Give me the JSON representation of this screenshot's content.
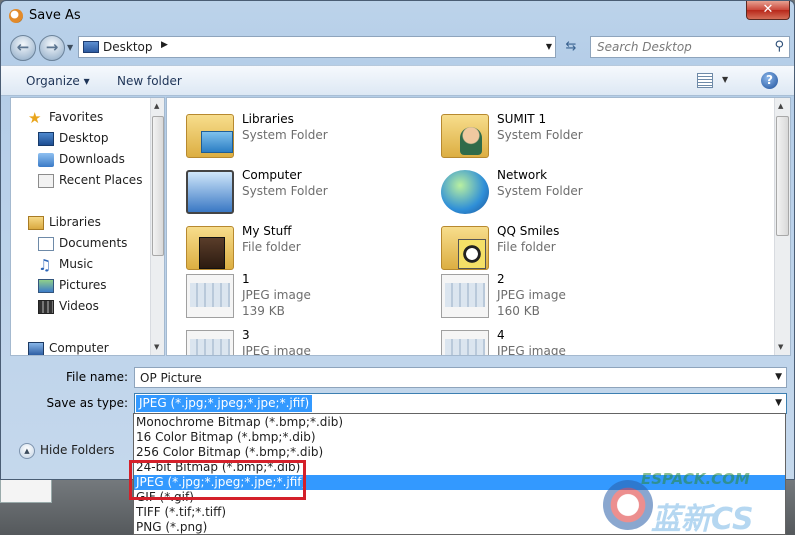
{
  "window": {
    "title": "Save As",
    "close_label": "✕"
  },
  "address": {
    "location": "Desktop",
    "search_placeholder": "Search Desktop"
  },
  "toolbar": {
    "organize": "Organize",
    "new_folder": "New folder"
  },
  "nav": {
    "favorites": "Favorites",
    "desktop": "Desktop",
    "downloads": "Downloads",
    "recent_places": "Recent Places",
    "libraries": "Libraries",
    "documents": "Documents",
    "music": "Music",
    "pictures": "Pictures",
    "videos": "Videos",
    "computer": "Computer"
  },
  "files": [
    {
      "name": "Libraries",
      "type": "System Folder",
      "size": "",
      "icon": "libraries-icon"
    },
    {
      "name": "SUMIT 1",
      "type": "System Folder",
      "size": "",
      "icon": "user-folder-icon"
    },
    {
      "name": "Computer",
      "type": "System Folder",
      "size": "",
      "icon": "computer-icon"
    },
    {
      "name": "Network",
      "type": "System Folder",
      "size": "",
      "icon": "network-icon"
    },
    {
      "name": "My Stuff",
      "type": "File folder",
      "size": "",
      "icon": "folder-icon"
    },
    {
      "name": "QQ Smiles",
      "type": "File folder",
      "size": "",
      "icon": "folder-icon"
    },
    {
      "name": "1",
      "type": "JPEG image",
      "size": "139 KB",
      "icon": "jpeg-thumbnail-icon"
    },
    {
      "name": "2",
      "type": "JPEG image",
      "size": "160 KB",
      "icon": "jpeg-thumbnail-icon"
    },
    {
      "name": "3",
      "type": "JPEG image",
      "size": "",
      "icon": "jpeg-thumbnail-icon"
    },
    {
      "name": "4",
      "type": "JPEG image",
      "size": "",
      "icon": "jpeg-thumbnail-icon"
    }
  ],
  "form": {
    "file_name_label": "File name:",
    "file_name_value": "OP Picture",
    "save_type_label": "Save as type:",
    "save_type_value": "JPEG (*.jpg;*.jpeg;*.jpe;*.jfif)"
  },
  "type_options": [
    "Monochrome Bitmap (*.bmp;*.dib)",
    "16 Color Bitmap (*.bmp;*.dib)",
    "256 Color Bitmap (*.bmp;*.dib)",
    "24-bit Bitmap (*.bmp;*.dib)",
    "JPEG (*.jpg;*.jpeg;*.jpe;*.jfif)",
    "GIF (*.gif)",
    "TIFF (*.tif;*.tiff)",
    "PNG (*.png)"
  ],
  "selected_option_index": 4,
  "hide_folders": "Hide Folders",
  "watermark": {
    "line1": "ESPACK.COM",
    "line2": "蓝新CS"
  },
  "colors": {
    "selection": "#3399ff",
    "highlight_box": "#d4202a"
  }
}
